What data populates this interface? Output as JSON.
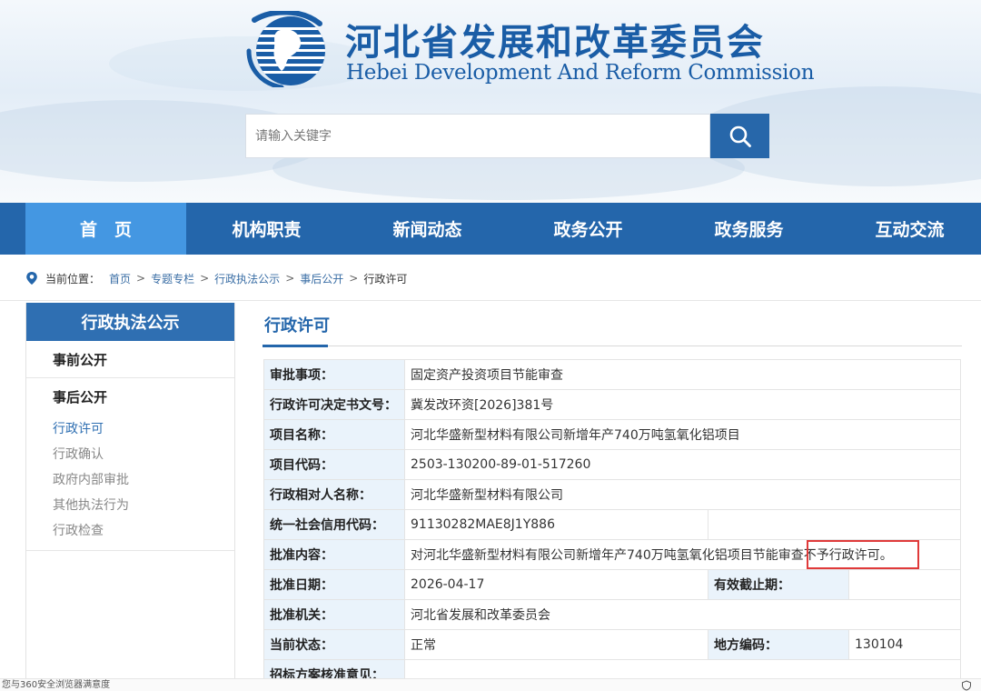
{
  "header": {
    "title_cn": "河北省发展和改革委员会",
    "title_en": "Hebei Development And Reform Commission"
  },
  "search": {
    "placeholder": "请输入关键字",
    "icon": "search-icon"
  },
  "nav": {
    "items": [
      {
        "label": "首　页"
      },
      {
        "label": "机构职责"
      },
      {
        "label": "新闻动态"
      },
      {
        "label": "政务公开"
      },
      {
        "label": "政务服务"
      },
      {
        "label": "互动交流"
      }
    ]
  },
  "breadcrumb": {
    "prefix": "当前位置：",
    "items": [
      "首页",
      "专题专栏",
      "行政执法公示",
      "事后公开"
    ],
    "current": "行政许可",
    "separator": ">"
  },
  "sidebar": {
    "heading": "行政执法公示",
    "section_before": "事前公开",
    "section_after": "事后公开",
    "sub_items": [
      "行政许可",
      "行政确认",
      "政府内部审批",
      "其他执法行为",
      "行政检查"
    ]
  },
  "content": {
    "title": "行政许可",
    "rows": {
      "approval_item": {
        "label": "审批事项：",
        "value": "固定资产投资项目节能审查"
      },
      "doc_number": {
        "label": "行政许可决定书文号：",
        "value": "冀发改环资[2026]381号"
      },
      "project_name": {
        "label": "项目名称：",
        "value": "河北华盛新型材料有限公司新增年产740万吨氢氧化铝项目"
      },
      "project_code": {
        "label": "项目代码：",
        "value": "2503-130200-89-01-517260"
      },
      "counterparty": {
        "label": "行政相对人名称：",
        "value": "河北华盛新型材料有限公司"
      },
      "credit_code": {
        "label": "统一社会信用代码：",
        "value": "91130282MAE8J1Y886"
      },
      "content": {
        "label": "批准内容：",
        "value": "对河北华盛新型材料有限公司新增年产740万吨氢氧化铝项目节能审查不予行政许可。"
      },
      "approval_date": {
        "label": "批准日期：",
        "value": "2026-04-17"
      },
      "valid_until": {
        "label": "有效截止期：",
        "value": ""
      },
      "authority": {
        "label": "批准机关：",
        "value": "河北省发展和改革委员会"
      },
      "status": {
        "label": "当前状态：",
        "value": "正常"
      },
      "region_code": {
        "label": "地方编码：",
        "value": "130104"
      },
      "tender_opinion": {
        "label": "招标方案核准意见：",
        "value": ""
      }
    }
  },
  "statusbar": {
    "text": "您与360安全浏览器满意度"
  },
  "colors": {
    "brand_blue": "#2466ab",
    "nav_active": "#4497e2",
    "label_bg": "#eaf3fb",
    "highlight_red": "#e03a3a"
  }
}
